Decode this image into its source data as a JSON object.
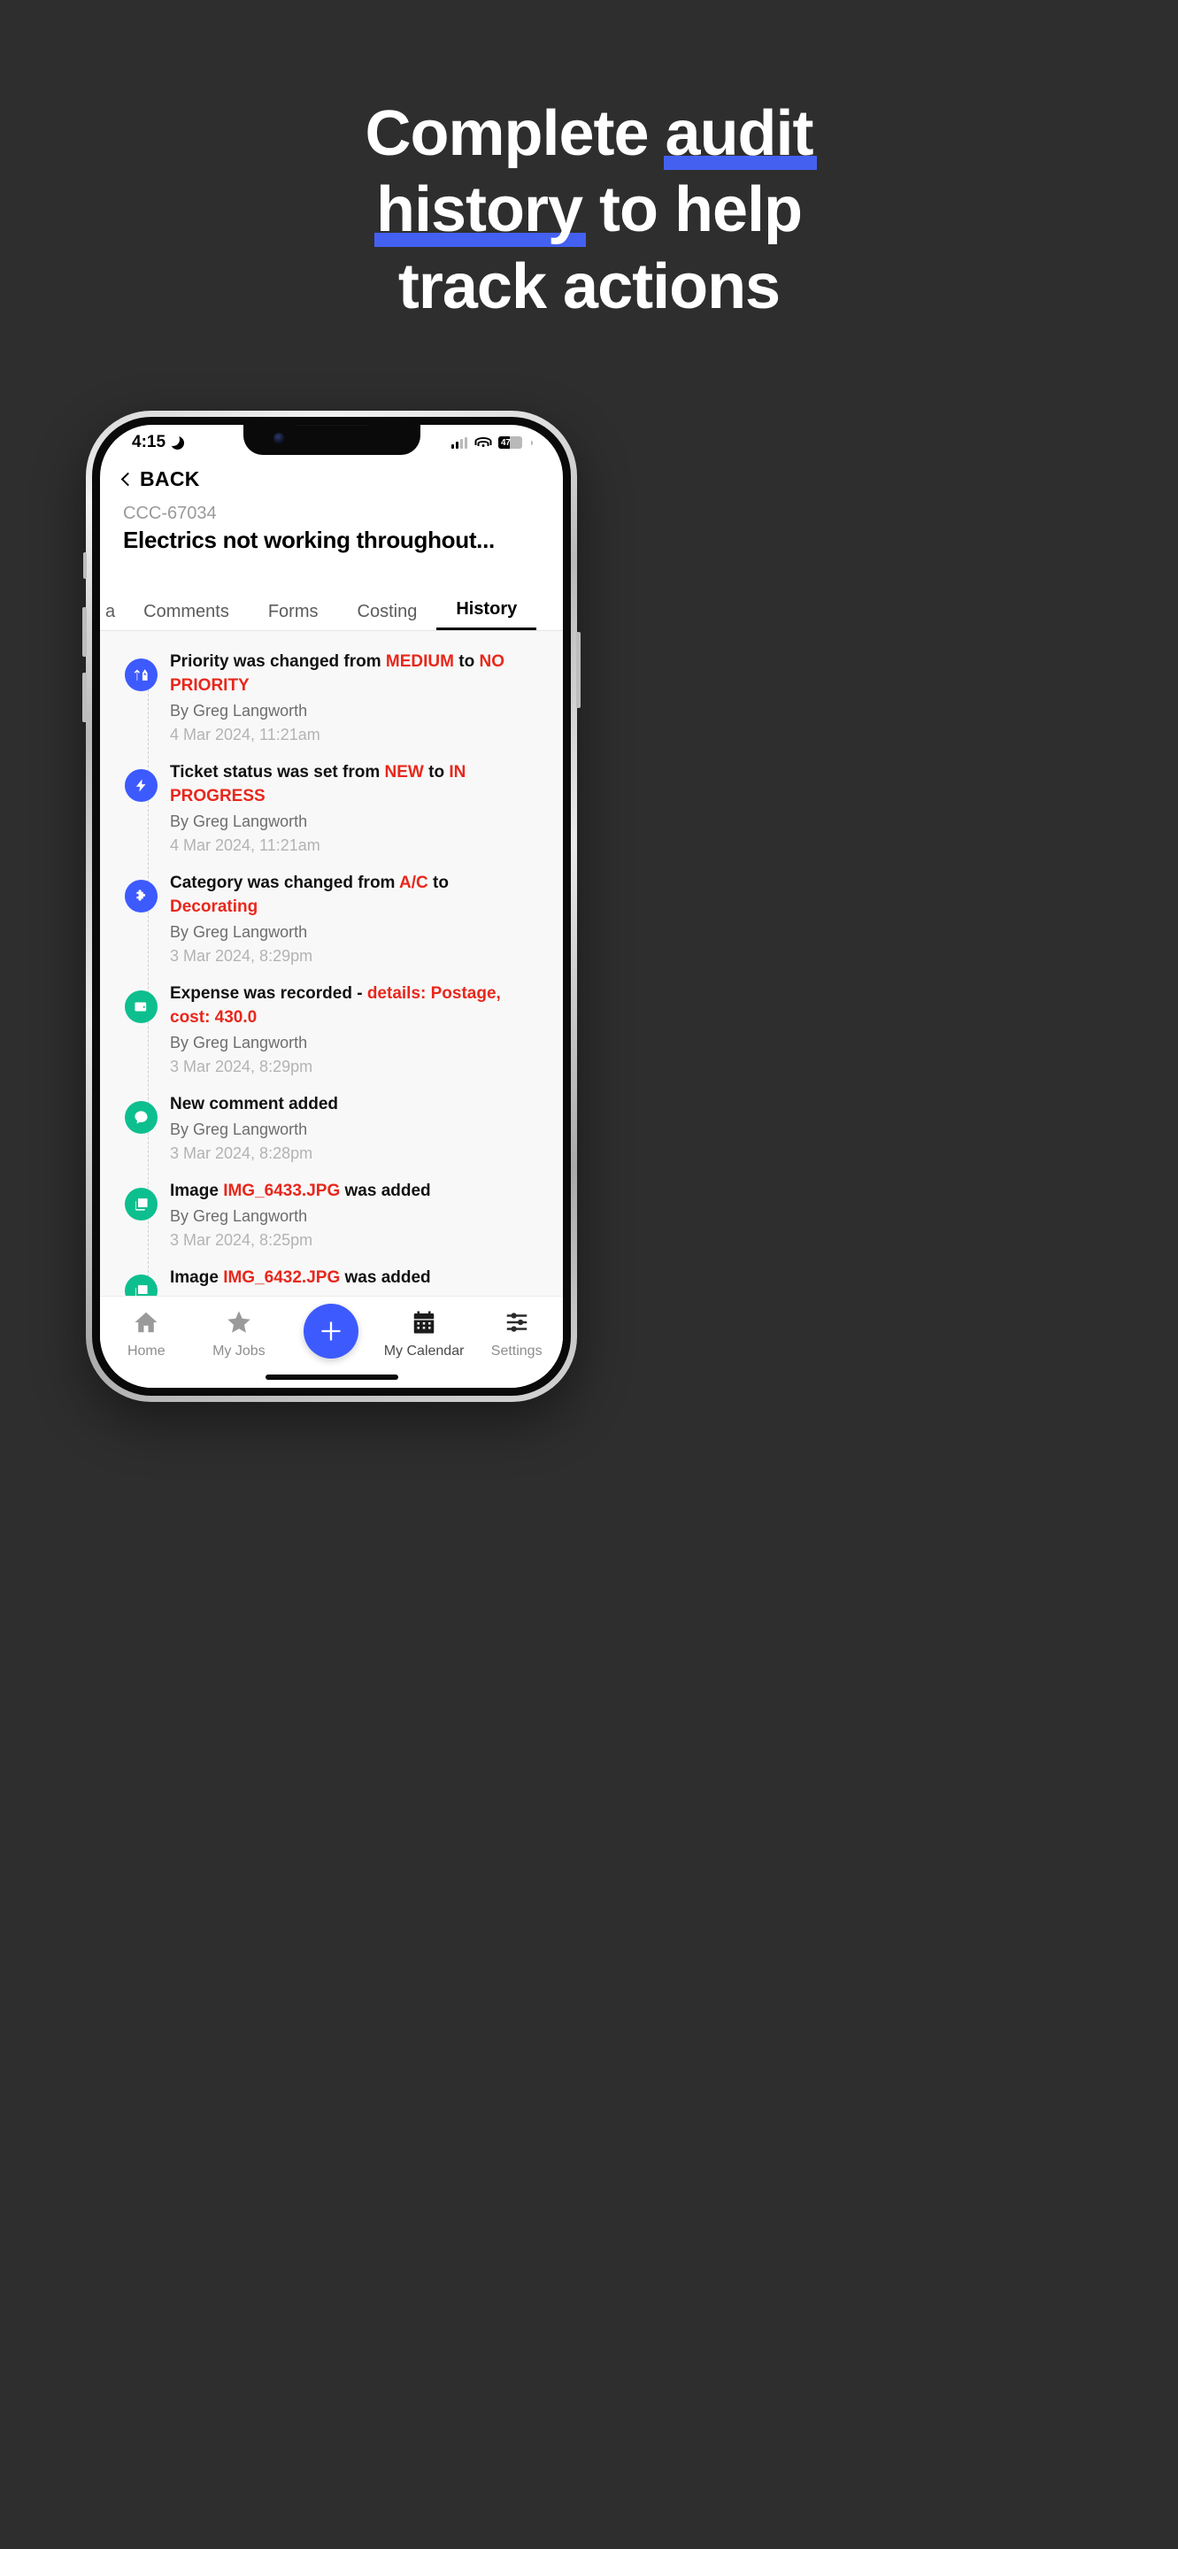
{
  "promo": {
    "lines": [
      {
        "parts": [
          {
            "text": "Complete ",
            "underline": false
          },
          {
            "text": "audit",
            "underline": true
          }
        ]
      },
      {
        "parts": [
          {
            "text": "history",
            "underline": true
          },
          {
            "text": " to help",
            "underline": false
          }
        ]
      },
      {
        "parts": [
          {
            "text": "track actions",
            "underline": false
          }
        ]
      }
    ],
    "plain_text": "Complete audit history to help track actions",
    "underline_color": "#4460f1",
    "text_color": "#ffffff",
    "background_color": "#2e2e2e"
  },
  "status_bar": {
    "time": "4:15",
    "moon_icon": "crescent-moon-icon",
    "cellular_icon": "signal-bars-icon",
    "wifi_icon": "wifi-icon",
    "battery_level": "47"
  },
  "header": {
    "back_label": "BACK",
    "back_icon": "chevron-left-icon",
    "ticket_id": "CCC-67034",
    "ticket_title": "Electrics not working throughout..."
  },
  "tabs": {
    "items": [
      {
        "label": "a",
        "active": false,
        "cut": true
      },
      {
        "label": "Comments",
        "active": false
      },
      {
        "label": "Forms",
        "active": false
      },
      {
        "label": "Costing",
        "active": false
      },
      {
        "label": "History",
        "active": true
      }
    ]
  },
  "history": {
    "items": [
      {
        "icon": "priority-arrows-icon",
        "icon_color": "#3d5afe",
        "segments": [
          {
            "text": "Priority was changed from ",
            "highlight": false
          },
          {
            "text": "MEDIUM",
            "highlight": true
          },
          {
            "text": " to ",
            "highlight": false
          },
          {
            "text": "NO PRIORITY",
            "highlight": true
          }
        ],
        "by": "By Greg Langworth",
        "date": "4 Mar 2024, 11:21am"
      },
      {
        "icon": "lightning-bolt-icon",
        "icon_color": "#3d5afe",
        "segments": [
          {
            "text": "Ticket status was set from ",
            "highlight": false
          },
          {
            "text": "NEW",
            "highlight": true
          },
          {
            "text": " to ",
            "highlight": false
          },
          {
            "text": "IN PROGRESS",
            "highlight": true
          }
        ],
        "by": "By Greg Langworth",
        "date": "4 Mar 2024, 11:21am"
      },
      {
        "icon": "puzzle-piece-icon",
        "icon_color": "#3d5afe",
        "segments": [
          {
            "text": "Category was changed from ",
            "highlight": false
          },
          {
            "text": "A/C",
            "highlight": true
          },
          {
            "text": " to ",
            "highlight": false
          },
          {
            "text": "Decorating",
            "highlight": true
          }
        ],
        "by": "By Greg Langworth",
        "date": "3 Mar 2024, 8:29pm"
      },
      {
        "icon": "wallet-icon",
        "icon_color": "#0dbf8f",
        "segments": [
          {
            "text": "Expense was recorded - ",
            "highlight": false
          },
          {
            "text": "details: Postage, cost: 430.0",
            "highlight": true
          }
        ],
        "by": "By Greg Langworth",
        "date": "3 Mar 2024, 8:29pm"
      },
      {
        "icon": "comment-bubble-icon",
        "icon_color": "#0dbf8f",
        "segments": [
          {
            "text": "New comment added",
            "highlight": false
          }
        ],
        "by": "By Greg Langworth",
        "date": "3 Mar 2024, 8:28pm"
      },
      {
        "icon": "image-icon",
        "icon_color": "#0dbf8f",
        "segments": [
          {
            "text": "Image ",
            "highlight": false
          },
          {
            "text": "IMG_6433.JPG",
            "highlight": true
          },
          {
            "text": " was added",
            "highlight": false
          }
        ],
        "by": "By Greg Langworth",
        "date": "3 Mar 2024, 8:25pm"
      },
      {
        "icon": "image-icon",
        "icon_color": "#0dbf8f",
        "segments": [
          {
            "text": "Image ",
            "highlight": false
          },
          {
            "text": "IMG_6432.JPG",
            "highlight": true
          },
          {
            "text": " was added",
            "highlight": false
          }
        ],
        "by": "",
        "date": ""
      }
    ],
    "highlight_color": "#e8271c"
  },
  "bottom_nav": {
    "items": [
      {
        "label": "Home",
        "icon": "home-icon",
        "active": false
      },
      {
        "label": "My Jobs",
        "icon": "star-icon",
        "active": false
      },
      {
        "label": "",
        "icon": "plus-icon",
        "fab": true
      },
      {
        "label": "My Calendar",
        "icon": "calendar-icon",
        "active": true
      },
      {
        "label": "Settings",
        "icon": "sliders-icon",
        "active": false
      }
    ],
    "fab_color": "#3d5afe"
  }
}
